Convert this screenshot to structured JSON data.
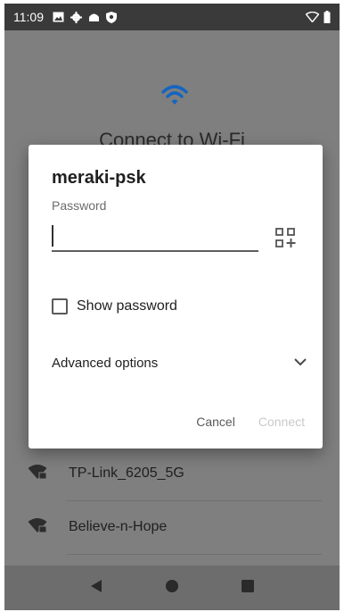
{
  "status_bar": {
    "time": "11:09",
    "notification_icons": [
      "image-icon",
      "gear-icon",
      "android-icon",
      "shield-icon"
    ],
    "system_icons": [
      "wifi-icon",
      "battery-icon"
    ]
  },
  "background": {
    "title": "Connect to Wi-Fi",
    "networks": [
      {
        "ssid": "TP-Link_6205_5G",
        "icon": "wifi-lock-icon"
      },
      {
        "ssid": "Believe-n-Hope",
        "icon": "wifi-lock-icon"
      }
    ]
  },
  "dialog": {
    "title": "meraki-psk",
    "password_label": "Password",
    "password_value": "",
    "show_password_label": "Show password",
    "show_password_checked": false,
    "advanced_label": "Advanced options",
    "cancel_label": "Cancel",
    "connect_label": "Connect"
  },
  "nav": {
    "buttons": [
      "back-icon",
      "home-icon",
      "recents-icon"
    ]
  },
  "colors": {
    "accent": "#1565c0",
    "scrim": "#7f7f7f",
    "status_bar": "#3a3a3a",
    "disabled_text": "#c9c9c9"
  }
}
